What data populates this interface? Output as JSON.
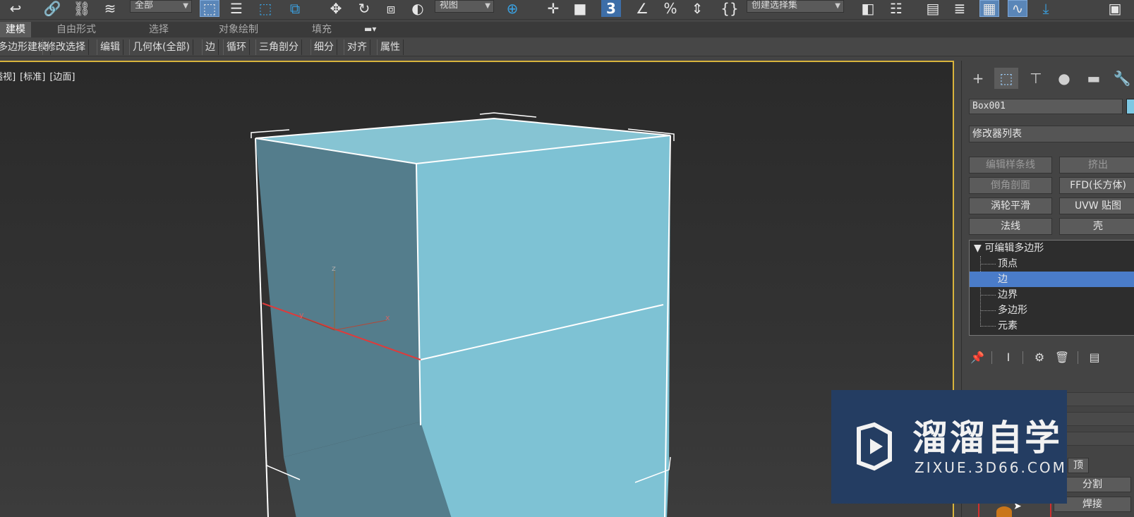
{
  "toolbar": {
    "selection_filter": "全部",
    "reference_coord": "视图",
    "named_selection": "创建选择集",
    "snap_level": "3"
  },
  "ribbon": {
    "tabs": [
      "建模",
      "自由形式",
      "选择",
      "对象绘制",
      "填充"
    ],
    "sub_items": [
      "多边形建模",
      "修改选择",
      "编辑",
      "几何体(全部)",
      "边",
      "循环",
      "三角剖分",
      "细分",
      "对齐",
      "属性"
    ]
  },
  "viewport": {
    "labels": [
      "[+]",
      "[透视]",
      "[标准]",
      "[边面]"
    ],
    "axis_x": "x",
    "axis_y": "y",
    "axis_z": "z",
    "object_color": "#7ec2d4",
    "side_color": "#547d8c",
    "border_color": "#d9b43c"
  },
  "panel": {
    "object_name": "Box001",
    "modifier_list": "修改器列表",
    "modifier_buttons": [
      "编辑样条线",
      "挤出",
      "倒角剖面",
      "FFD(长方体)",
      "涡轮平滑",
      "UVW 贴图",
      "法线",
      "壳"
    ],
    "stack_root": "可编辑多边形",
    "stack_children": [
      "顶点",
      "边",
      "边界",
      "多边形",
      "元素"
    ],
    "selected_child": "边",
    "partial_buttons": [
      "分割",
      "焊接"
    ],
    "partial_label": "顶"
  },
  "watermark": {
    "title": "溜溜自学",
    "subtitle": "ZIXUE.3D66.COM",
    "bg": "#243d62"
  }
}
